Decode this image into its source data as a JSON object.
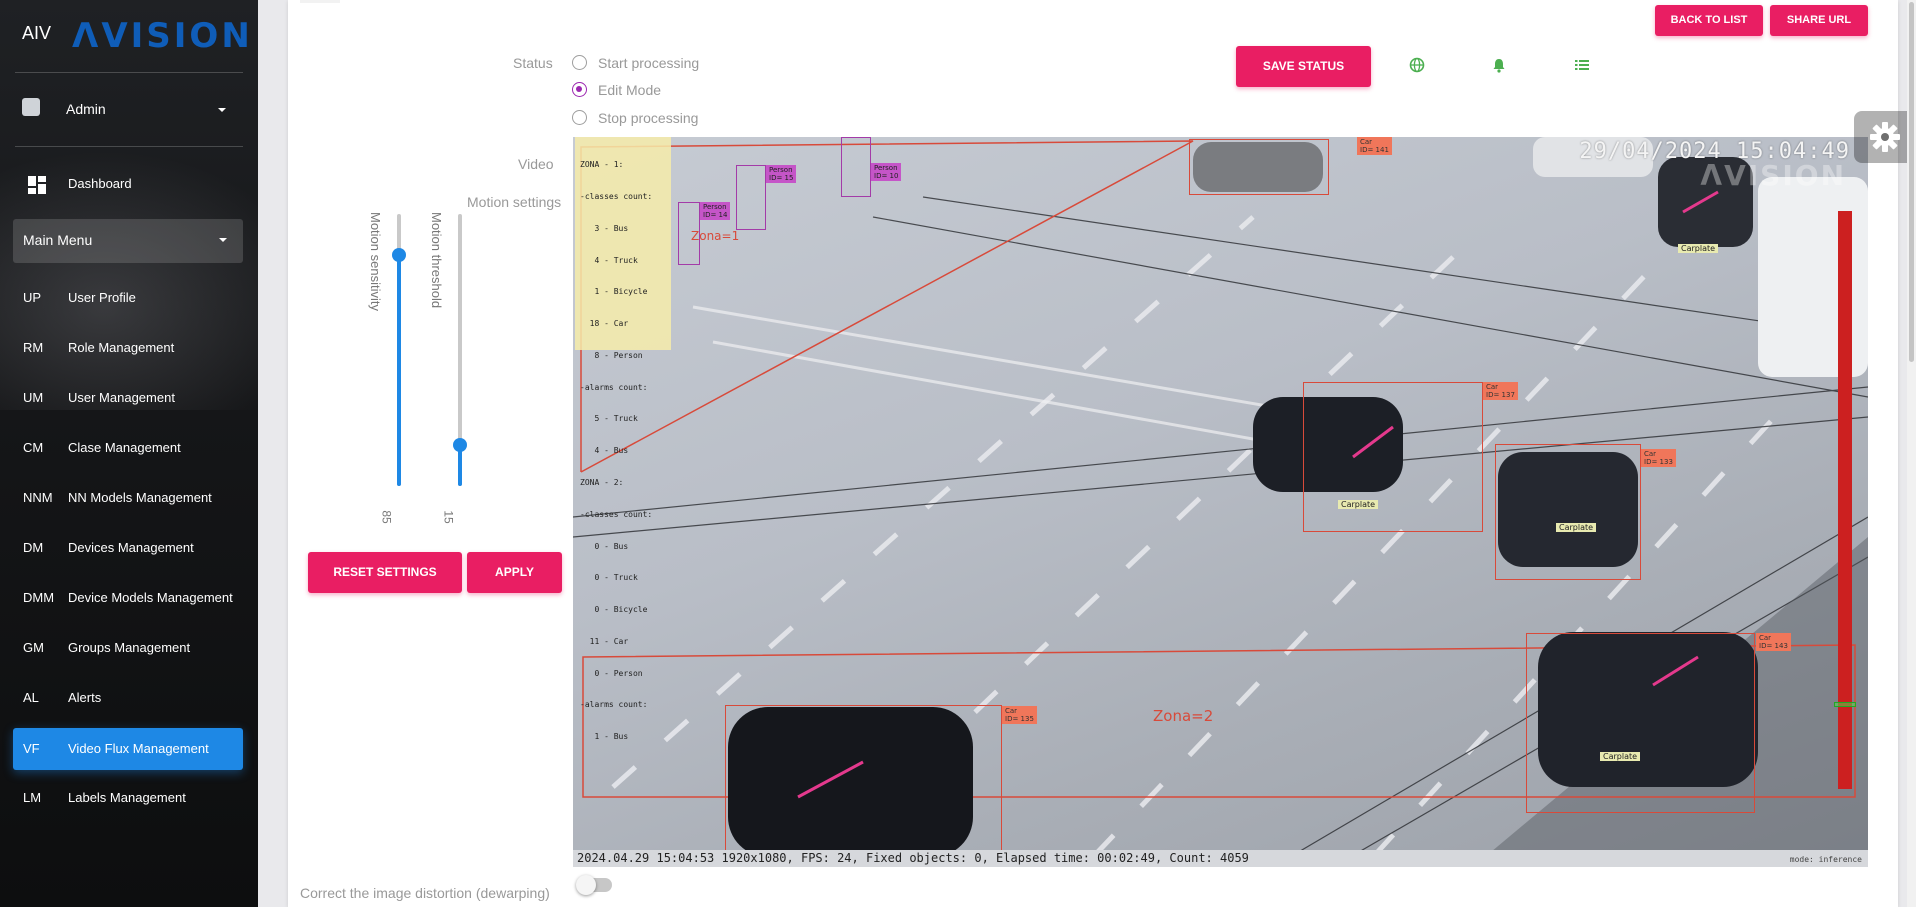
{
  "brand": {
    "mini": "AIV",
    "logo": "ΛVISION"
  },
  "user": {
    "name": "Admin"
  },
  "sidebar": {
    "dashboard": "Dashboard",
    "main_menu": "Main Menu",
    "items": [
      {
        "abbr": "UP",
        "label": "User Profile"
      },
      {
        "abbr": "RM",
        "label": "Role Management"
      },
      {
        "abbr": "UM",
        "label": "User Management"
      },
      {
        "abbr": "CM",
        "label": "Clase Management"
      },
      {
        "abbr": "NNM",
        "label": "NN Models Management"
      },
      {
        "abbr": "DM",
        "label": "Devices Management"
      },
      {
        "abbr": "DMM",
        "label": "Device Models Management"
      },
      {
        "abbr": "GM",
        "label": "Groups Management"
      },
      {
        "abbr": "AL",
        "label": "Alerts"
      },
      {
        "abbr": "VF",
        "label": "Video Flux Management",
        "active": true
      },
      {
        "abbr": "LM",
        "label": "Labels Management"
      }
    ]
  },
  "header": {
    "back_label": "BACK TO LIST",
    "share_label": "SHARE URL"
  },
  "status": {
    "label": "Status",
    "options": [
      "Start processing",
      "Edit Mode",
      "Stop processing"
    ],
    "selected": "Edit Mode",
    "save_label": "SAVE STATUS",
    "icons": [
      "globe-icon",
      "bell-icon",
      "list-icon"
    ],
    "icon_color": "#4caf50"
  },
  "video_label": "Video",
  "motion": {
    "label": "Motion settings",
    "sensitivity": {
      "label": "Motion sensitivity",
      "value": "85",
      "level": 0.85
    },
    "threshold": {
      "label": "Motion threshold",
      "value": "15",
      "level": 0.15
    },
    "reset_label": "RESET SETTINGS",
    "apply_label": "APPLY"
  },
  "video": {
    "timestamp": "29/04/2024 15:04:49",
    "watermark": "ΛVISION",
    "footer": "2024.04.29 15:04:53  1920x1080, FPS: 24, Fixed objects: 0, Elapsed time: 00:02:49, Count: 4059",
    "mode": "mode: inference",
    "zone_legend": [
      "ZONA - 1:",
      "-classes count:",
      "   3 - Bus",
      "   4 - Truck",
      "   1 - Bicycle",
      "  18 - Car",
      "   8 - Person",
      "-alarms count:",
      "   5 - Truck",
      "   4 - Bus",
      "ZONA - 2:",
      "-classes count:",
      "   0 - Bus",
      "   0 - Truck",
      "   0 - Bicycle",
      "  11 - Car",
      "   0 - Person",
      "-alarms count:",
      "   1 - Bus"
    ],
    "zone1_label": "Zona=1",
    "zone2_label": "Zona=2",
    "car_tags": [
      "Car\nID= 141",
      "Car\nID= 137",
      "Car\nID= 133",
      "Car\nID= 143",
      "Car\nID= 135"
    ],
    "person_tags": [
      "Person\nID= 14",
      "Person\nID= 15",
      "Person\nID= 10"
    ],
    "plate_label": "Carplate"
  },
  "dewarp": {
    "label": "Correct the image distortion (dewarping)",
    "enabled": false
  },
  "colors": {
    "accent": "#e91e63",
    "active_nav": "#1e88e5",
    "box_red": "#d84a3a",
    "box_person": "#a33ba8"
  }
}
